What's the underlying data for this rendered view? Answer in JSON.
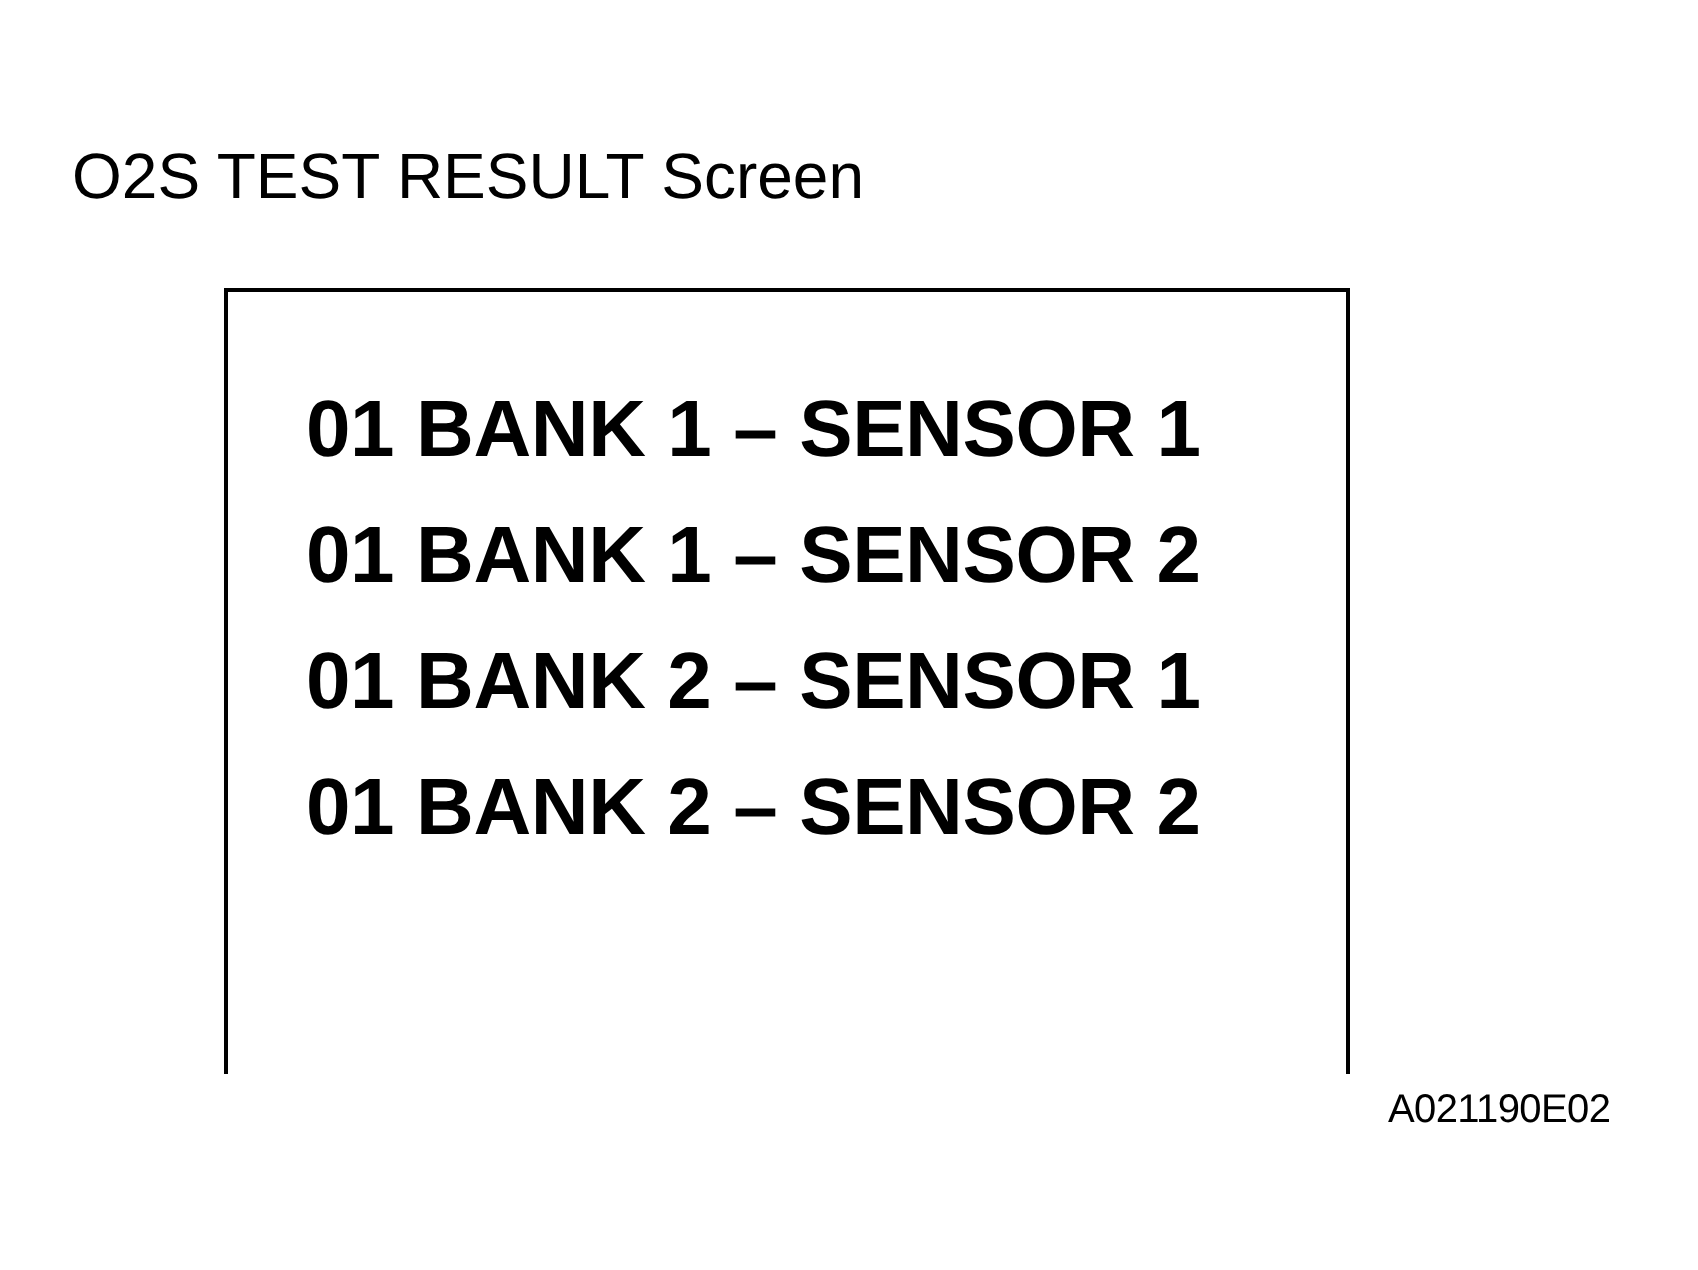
{
  "title": "O2S TEST RESULT Screen",
  "screen": {
    "lines": [
      "01 BANK 1 – SENSOR 1",
      "01 BANK 1 – SENSOR 2",
      "01 BANK 2 – SENSOR 1",
      "01 BANK 2 – SENSOR 2"
    ]
  },
  "figure_code": "A021190E02"
}
